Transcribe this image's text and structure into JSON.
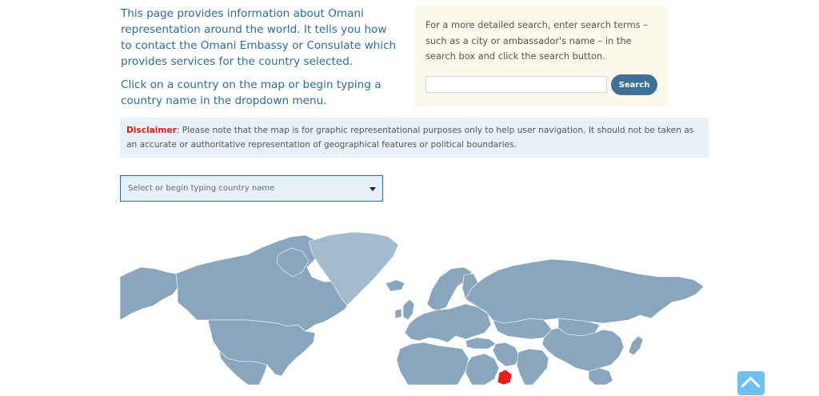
{
  "intro": {
    "paragraph1": "This page provides information about Omani representation around the world. It tells you how to contact the Omani Embassy or Consulate which provides services for the country selected.",
    "paragraph2": "Click on a country on the map or begin typing a country name in the dropdown menu."
  },
  "search": {
    "description": "For a more detailed search, enter search terms – such as a city or ambassador's name – in the search box and click the search button.",
    "input_value": "",
    "button_label": "Search"
  },
  "disclaimer": {
    "label": "Disclaimer",
    "text": ": Please note that the map is for graphic representational purposes only to help user navigation. It should not be taken as an accurate or authoritative representation of geographical features or political boundaries."
  },
  "country_select": {
    "placeholder": "Select or begin typing country name",
    "icon": "caret-down-icon"
  },
  "map": {
    "land_color": "#8aa6be",
    "greenland_color": "#a3bbcf",
    "highlight_color": "#ef1c1c",
    "highlight_country": "Oman"
  },
  "scroll_top": {
    "icon": "chevron-up-icon",
    "color": "#6ec1ef"
  }
}
